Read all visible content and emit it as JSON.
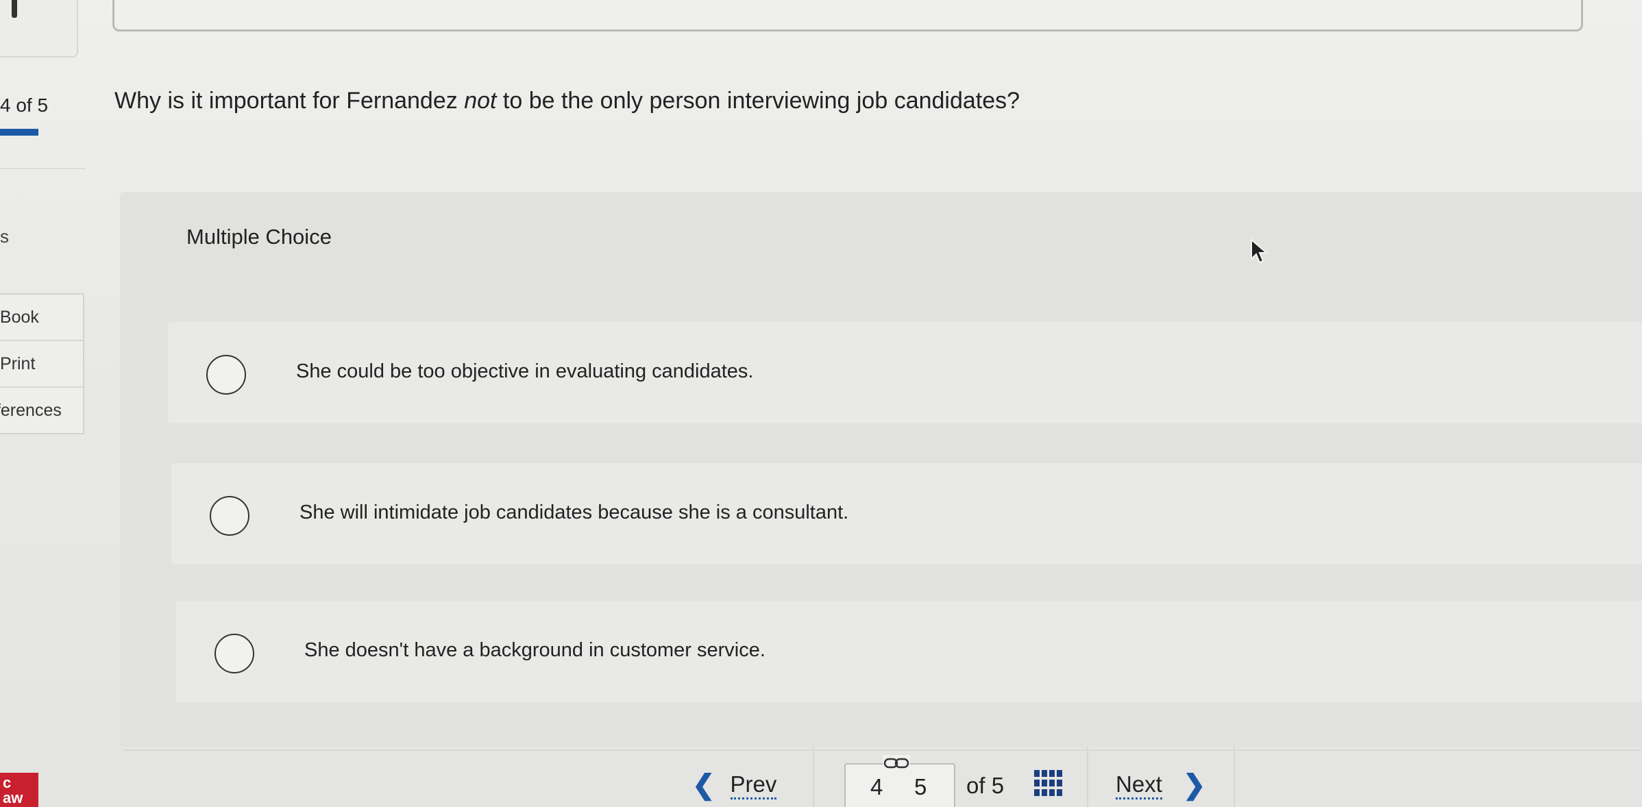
{
  "sidebar": {
    "progress_label": "4 of 5",
    "fragment_label": "s",
    "menu_items": [
      {
        "label": "eBook"
      },
      {
        "label": "Print"
      },
      {
        "label": "References"
      }
    ],
    "logo_text": "c\naw"
  },
  "question": {
    "prefix": "Why is it important for Fernandez ",
    "emphasis": "not",
    "suffix": " to be the only person interviewing job candidates?"
  },
  "panel": {
    "title": "Multiple Choice",
    "options": [
      {
        "label": "She could be too objective in evaluating candidates.",
        "selected": false
      },
      {
        "label": "She will intimidate job candidates because she is a consultant.",
        "selected": false
      },
      {
        "label": "She doesn't have a background in customer service.",
        "selected": false
      }
    ]
  },
  "navigation": {
    "prev_label": "Prev",
    "next_label": "Next",
    "current_page": "4",
    "other_page": "5",
    "of_total": "of 5"
  },
  "colors": {
    "accent": "#1c5aa6",
    "grid_icon": "#1a3f80",
    "logo": "#c8202e"
  },
  "icons": {
    "prev": "chevron-left-icon",
    "next": "chevron-right-icon",
    "grid": "grid-icon",
    "link": "link-icon",
    "radio": "radio-button"
  }
}
